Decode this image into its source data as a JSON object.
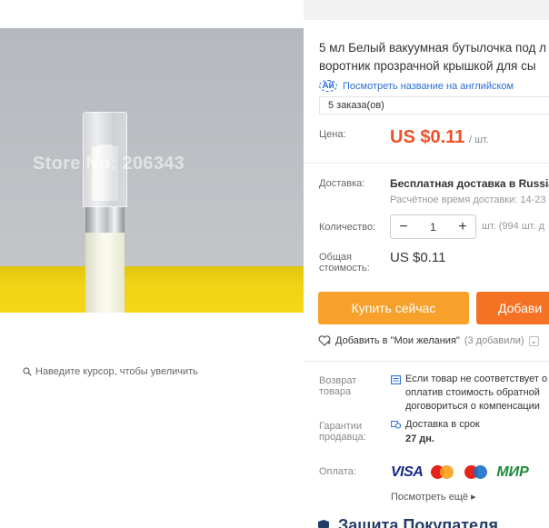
{
  "gallery": {
    "watermark": "Store No: 206343",
    "zoom_hint": "Наведите курсор, чтобы увеличить",
    "zoom_icon": "search-icon"
  },
  "product": {
    "title_line1": "5 мл Белый вакуумная бутылочка под л",
    "title_line2": "воротник прозрачной крышкой для сы",
    "translate_link": "Посмотреть название на английском",
    "translate_icon": "Aй",
    "orders": "5 заказа(ов)"
  },
  "price": {
    "label": "Цена:",
    "value": "US $0.11",
    "unit": "/ шт."
  },
  "shipping": {
    "label": "Доставка:",
    "main": "Бесплатная доставка в Russian",
    "sub": "Расчётное время доставки: 14-23"
  },
  "quantity": {
    "label": "Количество:",
    "minus": "−",
    "value": "1",
    "plus": "+",
    "stock": "шт. (994 шт. д"
  },
  "total": {
    "label_line1": "Общая",
    "label_line2": "стоимость:",
    "value": "US $0.11"
  },
  "actions": {
    "buy_now": "Купить сейчас",
    "add_to_cart": "Добави",
    "wishlist": "Добавить в \"Мои желания\"",
    "wishlist_count": "(3 добавили)",
    "wishlist_toggle": "⌄"
  },
  "services": {
    "return_label_line1": "Возврат",
    "return_label_line2": "товара",
    "return_line1": "Если товар не соответствует о",
    "return_line2": "оплатив стоимость обратной",
    "return_line3": "договориться о компенсации",
    "guarantee_label_line1": "Гарантии",
    "guarantee_label_line2": "продавца:",
    "guarantee_line1": "Доставка в срок",
    "guarantee_line2": "27 дн."
  },
  "payment": {
    "label": "Оплата:",
    "visa": "VISA",
    "mastercard_text": "MasterCard",
    "maestro_text": "Maestro",
    "mir": "МИР",
    "more": "Посмотреть ещё ▸"
  },
  "protection": {
    "title": "Защита Покупателя"
  },
  "colors": {
    "price": "#f0502a",
    "buy_button": "#f7a02a",
    "cart_button": "#f57224",
    "link": "#2a6fd6"
  }
}
